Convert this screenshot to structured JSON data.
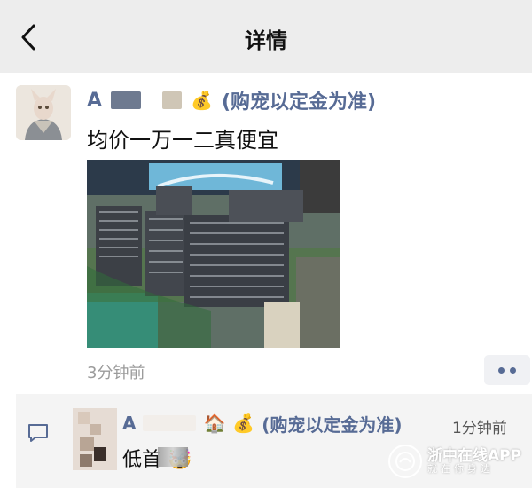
{
  "navbar": {
    "title": "详情",
    "back_icon": "chevron-left-icon"
  },
  "post": {
    "nickname": "A",
    "tag": "(购宠以定金为准)",
    "emoji": "💰",
    "text": "均价一万一二真便宜",
    "time": "3分钟前",
    "image_alt": "楼盘沙盘模型"
  },
  "comment": {
    "nickname": "A",
    "tag": "(购宠以定金为准)",
    "emoji_house": "🏠",
    "emoji_bag": "💰",
    "time": "1分钟前",
    "text_prefix": "低首",
    "emoji_face": "🤯"
  },
  "watermark": {
    "name": "浙中在线APP",
    "slogan": "就在你身边"
  },
  "colors": {
    "link": "#576b95",
    "navbar_bg": "#ededed",
    "comment_bg": "#f4f4f4"
  }
}
